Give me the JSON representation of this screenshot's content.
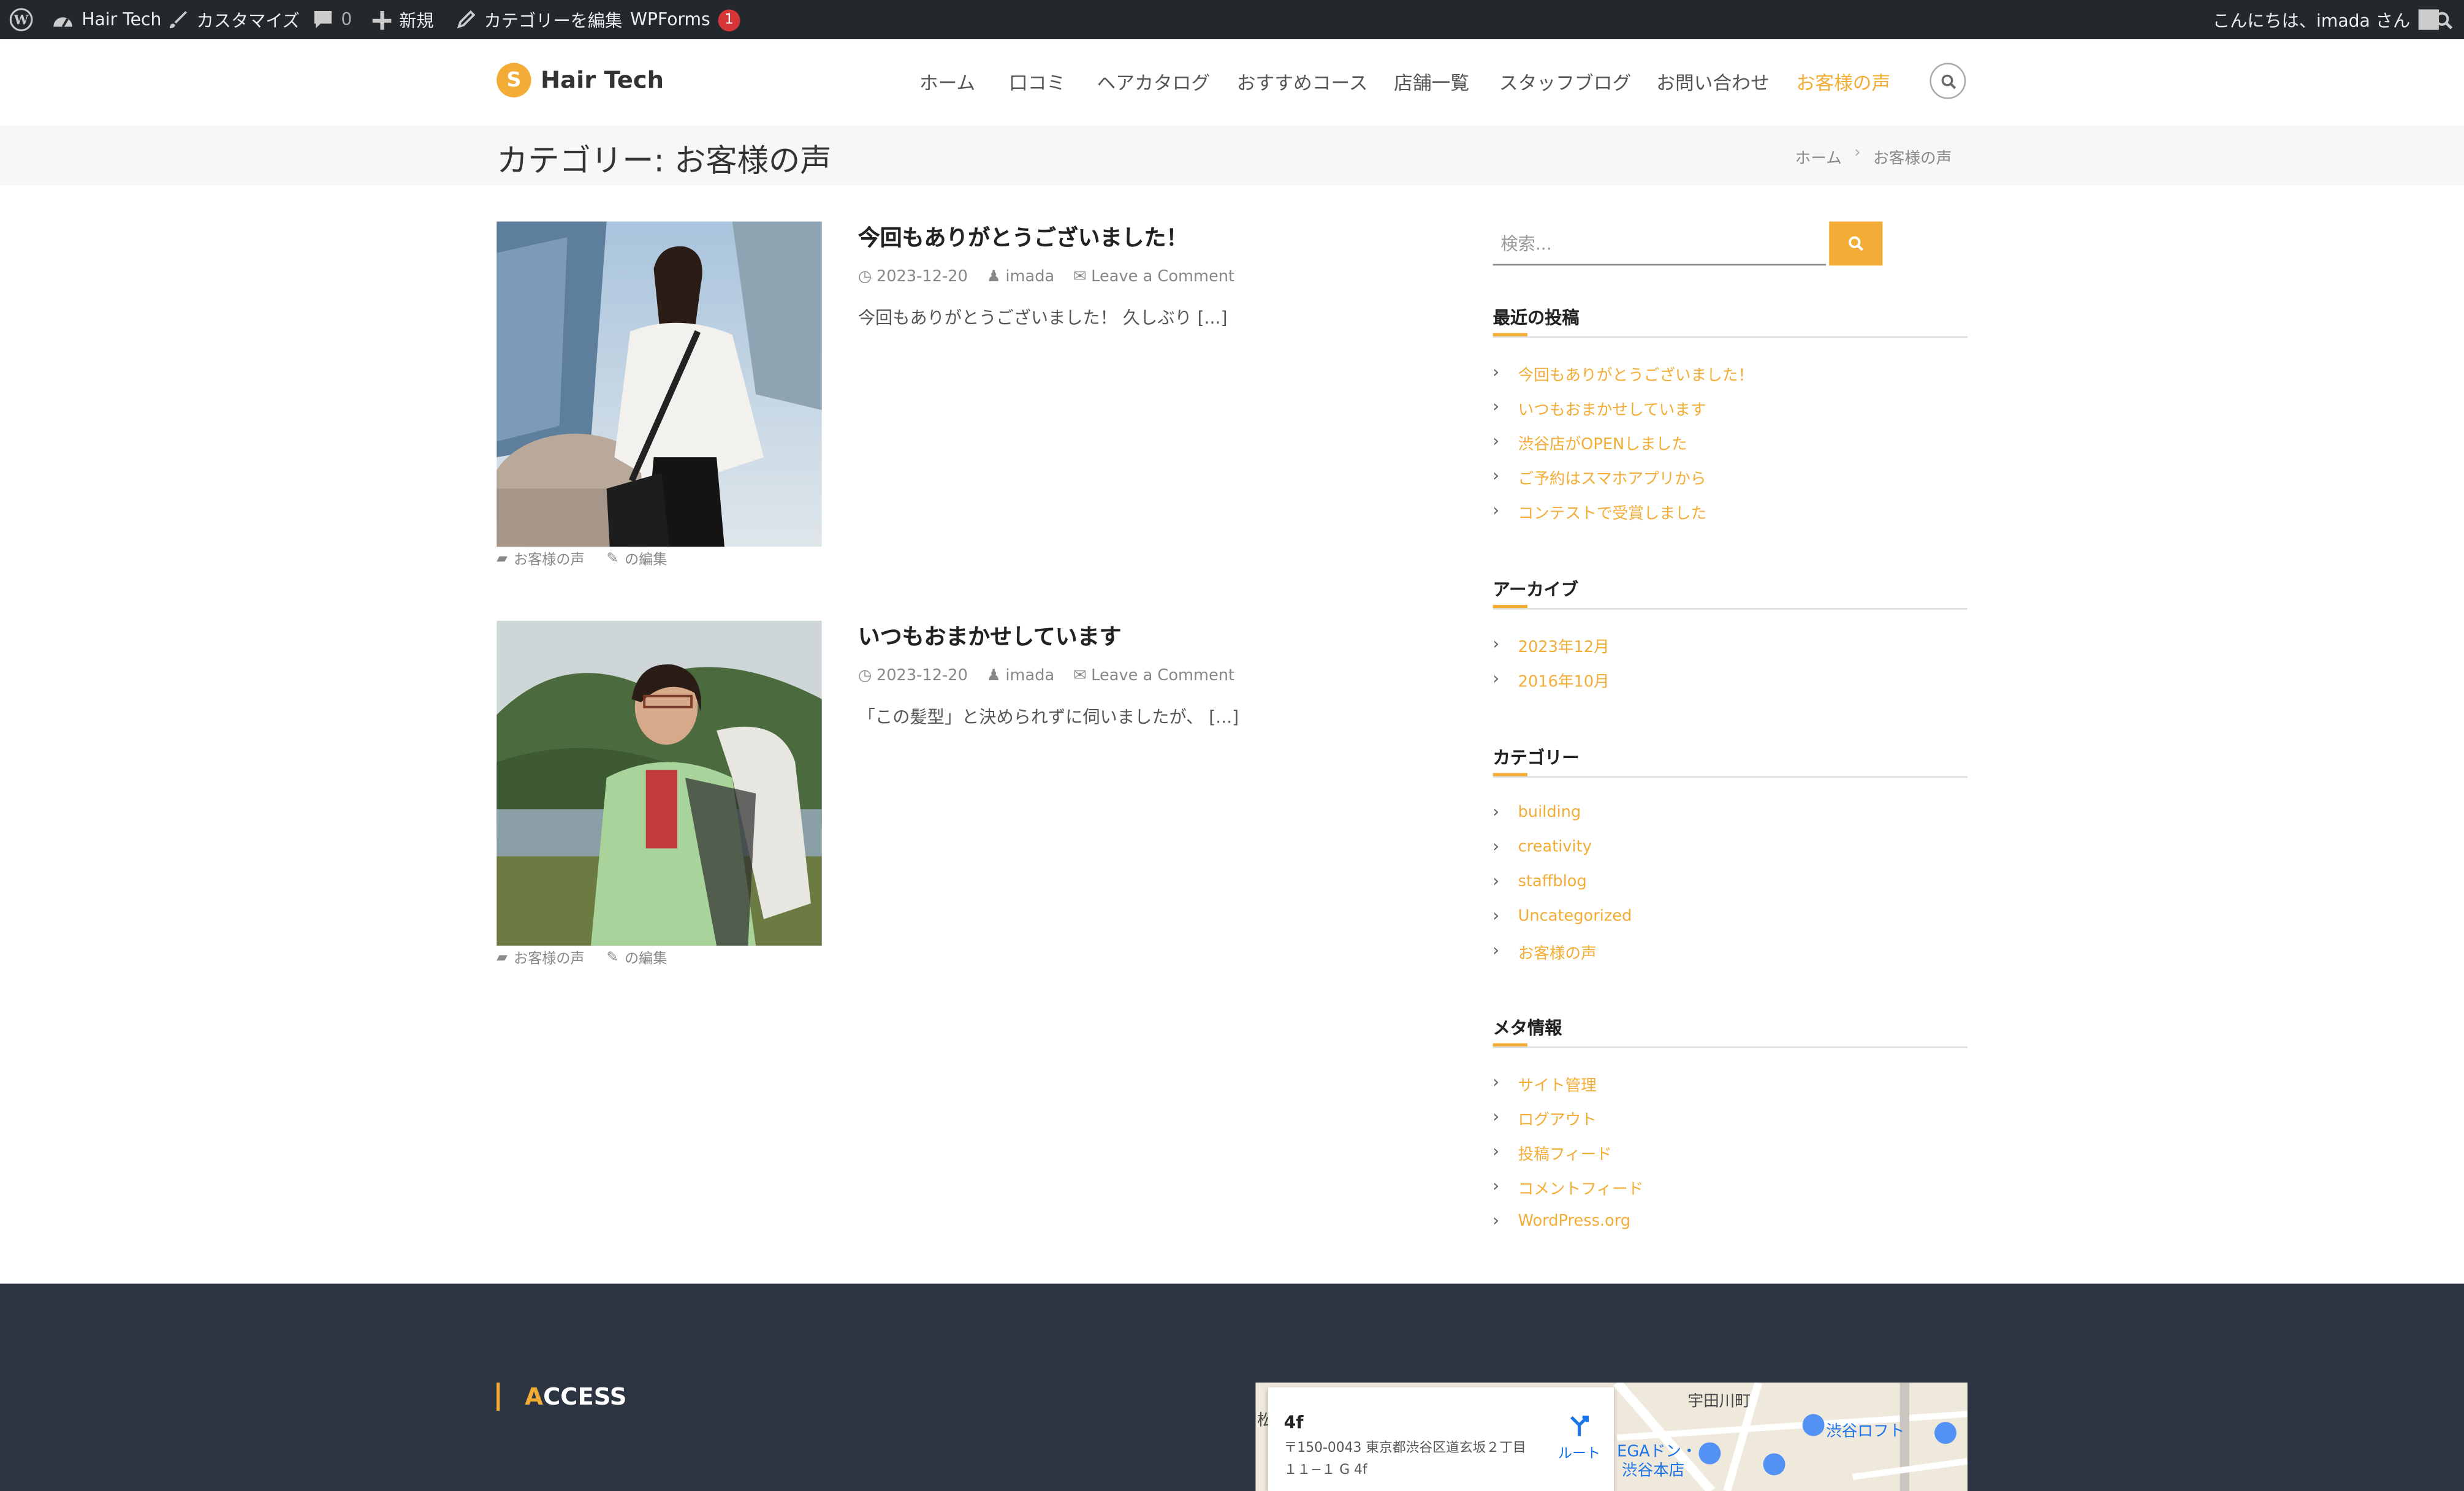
{
  "admin_bar": {
    "site_name": "Hair Tech",
    "customize": "カスタマイズ",
    "comments_count": "0",
    "new": "新規",
    "edit_category": "カテゴリーを編集",
    "wpforms": "WPForms",
    "wpforms_badge": "1",
    "greeting": "こんにちは、imada さん"
  },
  "header": {
    "logo_text": "Hair Tech",
    "nav": [
      "ホーム",
      "口コミ",
      "ヘアカタログ",
      "おすすめコース",
      "店舗一覧",
      "スタッフブログ",
      "お問い合わせ",
      "お客様の声"
    ],
    "active_index": 7
  },
  "title_band": {
    "title": "カテゴリー: お客様の声",
    "breadcrumb": [
      "ホーム",
      "お客様の声"
    ]
  },
  "posts": [
    {
      "title": "今回もありがとうございました！",
      "date": "2023-12-20",
      "author": "imada",
      "comments": "Leave a Comment",
      "excerpt": "今回もありがとうございました！ 久しぶり [...]",
      "category": "お客様の声",
      "edit": "の編集"
    },
    {
      "title": "いつもおまかせしています",
      "date": "2023-12-20",
      "author": "imada",
      "comments": "Leave a Comment",
      "excerpt": "「この髪型」と決められずに伺いましたが、 [...]",
      "category": "お客様の声",
      "edit": "の編集"
    }
  ],
  "sidebar": {
    "search_placeholder": "検索...",
    "recent": {
      "title": "最近の投稿",
      "items": [
        "今回もありがとうございました！",
        "いつもおまかせしています",
        "渋谷店がOPENしました",
        "ご予約はスマホアプリから",
        "コンテストで受賞しました"
      ]
    },
    "archive": {
      "title": "アーカイブ",
      "items": [
        "2023年12月",
        "2016年10月"
      ]
    },
    "categories": {
      "title": "カテゴリー",
      "items": [
        "building",
        "creativity",
        "staffblog",
        "Uncategorized",
        "お客様の声"
      ]
    },
    "meta": {
      "title": "メタ情報",
      "items": [
        "サイト管理",
        "ログアウト",
        "投稿フィード",
        "コメントフィード",
        "WordPress.org"
      ]
    }
  },
  "footer": {
    "access_first": "A",
    "access_rest": "CCESS",
    "map": {
      "place": "4f",
      "address": "〒150-0043 東京都渋谷区道玄坂２丁目１１−１ G 4f",
      "route": "ルート",
      "labels": [
        "宇田川町",
        "渋谷ロフト",
        "EGAドン・",
        "渋谷本店",
        "松"
      ]
    }
  },
  "colors": {
    "accent": "#f3ac36",
    "admin_bar": "#23282d",
    "footer": "#2d3441"
  }
}
